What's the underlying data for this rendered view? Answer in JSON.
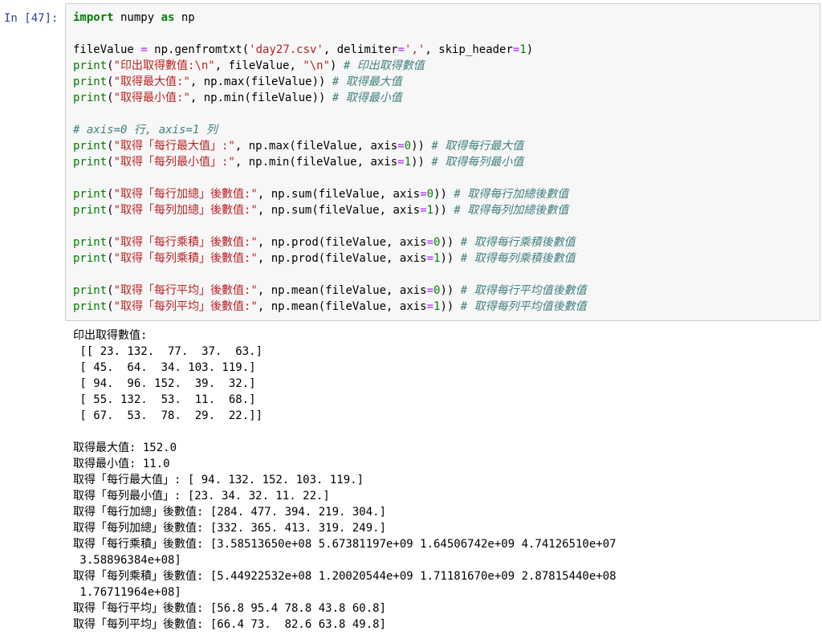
{
  "prompt": "In [47]:",
  "code_lines": [
    [
      {
        "t": "import",
        "c": "kw"
      },
      {
        "t": " numpy "
      },
      {
        "t": "as",
        "c": "kw"
      },
      {
        "t": " np"
      }
    ],
    [],
    [
      {
        "t": "fileValue "
      },
      {
        "t": "=",
        "c": "op"
      },
      {
        "t": " np.genfromtxt("
      },
      {
        "t": "'day27.csv'",
        "c": "str"
      },
      {
        "t": ", delimiter"
      },
      {
        "t": "=",
        "c": "op"
      },
      {
        "t": "','",
        "c": "str"
      },
      {
        "t": ", skip_header"
      },
      {
        "t": "=",
        "c": "op"
      },
      {
        "t": "1",
        "c": "num"
      },
      {
        "t": ")"
      }
    ],
    [
      {
        "t": "print",
        "c": "bi"
      },
      {
        "t": "("
      },
      {
        "t": "\"印出取得數值:\\n\"",
        "c": "str"
      },
      {
        "t": ", fileValue, "
      },
      {
        "t": "\"\\n\"",
        "c": "str"
      },
      {
        "t": ") "
      },
      {
        "t": "# 印出取得數值",
        "c": "com"
      }
    ],
    [
      {
        "t": "print",
        "c": "bi"
      },
      {
        "t": "("
      },
      {
        "t": "\"取得最大值:\"",
        "c": "str"
      },
      {
        "t": ", np.max(fileValue)) "
      },
      {
        "t": "# 取得最大值",
        "c": "com"
      }
    ],
    [
      {
        "t": "print",
        "c": "bi"
      },
      {
        "t": "("
      },
      {
        "t": "\"取得最小值:\"",
        "c": "str"
      },
      {
        "t": ", np.min(fileValue)) "
      },
      {
        "t": "# 取得最小值",
        "c": "com"
      }
    ],
    [],
    [
      {
        "t": "# axis=0 行, axis=1 列",
        "c": "com"
      }
    ],
    [
      {
        "t": "print",
        "c": "bi"
      },
      {
        "t": "("
      },
      {
        "t": "\"取得「每行最大值」:\"",
        "c": "str"
      },
      {
        "t": ", np.max(fileValue, axis"
      },
      {
        "t": "=",
        "c": "op"
      },
      {
        "t": "0",
        "c": "num"
      },
      {
        "t": ")) "
      },
      {
        "t": "# 取得每行最大值",
        "c": "com"
      }
    ],
    [
      {
        "t": "print",
        "c": "bi"
      },
      {
        "t": "("
      },
      {
        "t": "\"取得「每列最小值」:\"",
        "c": "str"
      },
      {
        "t": ", np.min(fileValue, axis"
      },
      {
        "t": "=",
        "c": "op"
      },
      {
        "t": "1",
        "c": "num"
      },
      {
        "t": ")) "
      },
      {
        "t": "# 取得每列最小值",
        "c": "com"
      }
    ],
    [],
    [
      {
        "t": "print",
        "c": "bi"
      },
      {
        "t": "("
      },
      {
        "t": "\"取得「每行加總」後數值:\"",
        "c": "str"
      },
      {
        "t": ", np.sum(fileValue, axis"
      },
      {
        "t": "=",
        "c": "op"
      },
      {
        "t": "0",
        "c": "num"
      },
      {
        "t": ")) "
      },
      {
        "t": "# 取得每行加總後數值",
        "c": "com"
      }
    ],
    [
      {
        "t": "print",
        "c": "bi"
      },
      {
        "t": "("
      },
      {
        "t": "\"取得「每列加總」後數值:\"",
        "c": "str"
      },
      {
        "t": ", np.sum(fileValue, axis"
      },
      {
        "t": "=",
        "c": "op"
      },
      {
        "t": "1",
        "c": "num"
      },
      {
        "t": ")) "
      },
      {
        "t": "# 取得每列加總後數值",
        "c": "com"
      }
    ],
    [],
    [
      {
        "t": "print",
        "c": "bi"
      },
      {
        "t": "("
      },
      {
        "t": "\"取得「每行乘積」後數值:\"",
        "c": "str"
      },
      {
        "t": ", np.prod(fileValue, axis"
      },
      {
        "t": "=",
        "c": "op"
      },
      {
        "t": "0",
        "c": "num"
      },
      {
        "t": ")) "
      },
      {
        "t": "# 取得每行乘積後數值",
        "c": "com"
      }
    ],
    [
      {
        "t": "print",
        "c": "bi"
      },
      {
        "t": "("
      },
      {
        "t": "\"取得「每列乘積」後數值:\"",
        "c": "str"
      },
      {
        "t": ", np.prod(fileValue, axis"
      },
      {
        "t": "=",
        "c": "op"
      },
      {
        "t": "1",
        "c": "num"
      },
      {
        "t": ")) "
      },
      {
        "t": "# 取得每列乘積後數值",
        "c": "com"
      }
    ],
    [],
    [
      {
        "t": "print",
        "c": "bi"
      },
      {
        "t": "("
      },
      {
        "t": "\"取得「每行平均」後數值:\"",
        "c": "str"
      },
      {
        "t": ", np.mean(fileValue, axis"
      },
      {
        "t": "=",
        "c": "op"
      },
      {
        "t": "0",
        "c": "num"
      },
      {
        "t": ")) "
      },
      {
        "t": "# 取得每行平均值後數值",
        "c": "com"
      }
    ],
    [
      {
        "t": "print",
        "c": "bi"
      },
      {
        "t": "("
      },
      {
        "t": "\"取得「每列平均」後數值:\"",
        "c": "str"
      },
      {
        "t": ", np.mean(fileValue, axis"
      },
      {
        "t": "=",
        "c": "op"
      },
      {
        "t": "1",
        "c": "num"
      },
      {
        "t": ")) "
      },
      {
        "t": "# 取得每列平均值後數值",
        "c": "com"
      }
    ]
  ],
  "output_lines": [
    "印出取得數值:",
    " [[ 23. 132.  77.  37.  63.]",
    " [ 45.  64.  34. 103. 119.]",
    " [ 94.  96. 152.  39.  32.]",
    " [ 55. 132.  53.  11.  68.]",
    " [ 67.  53.  78.  29.  22.]]",
    "",
    "取得最大值: 152.0",
    "取得最小值: 11.0",
    "取得「每行最大值」: [ 94. 132. 152. 103. 119.]",
    "取得「每列最小值」: [23. 34. 32. 11. 22.]",
    "取得「每行加總」後數值: [284. 477. 394. 219. 304.]",
    "取得「每列加總」後數值: [332. 365. 413. 319. 249.]",
    "取得「每行乘積」後數值: [3.58513650e+08 5.67381197e+09 1.64506742e+09 4.74126510e+07",
    " 3.58896384e+08]",
    "取得「每列乘積」後數值: [5.44922532e+08 1.20020544e+09 1.71181670e+09 2.87815440e+08",
    " 1.76711964e+08]",
    "取得「每行平均」後數值: [56.8 95.4 78.8 43.8 60.8]",
    "取得「每列平均」後數值: [66.4 73.  82.6 63.8 49.8]"
  ]
}
